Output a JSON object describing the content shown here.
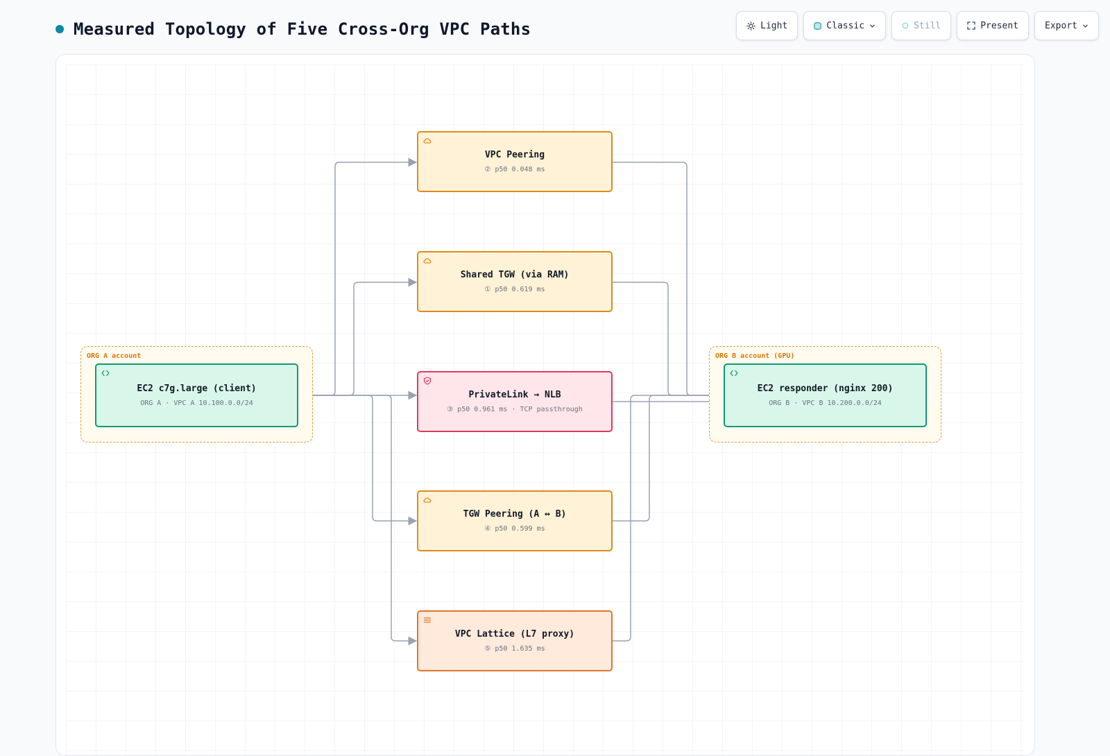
{
  "header": {
    "title": "Measured Topology of Five Cross-Org VPC Paths",
    "accent_color": "#0e87a8"
  },
  "toolbar": {
    "light": {
      "label": "Light",
      "icon": "sun-icon"
    },
    "classic": {
      "label": "Classic",
      "icon": "palette-swatch-icon"
    },
    "still": {
      "label": "Still",
      "icon": "circle-icon"
    },
    "present": {
      "label": "Present",
      "icon": "fullscreen-icon"
    },
    "export": {
      "label": "Export",
      "icon": "chevron-down-icon"
    }
  },
  "groups": {
    "org_a": {
      "label": "ORG A account"
    },
    "org_b": {
      "label": "ORG B account (GPU)"
    }
  },
  "nodes": {
    "client": {
      "title": "EC2 c7g.large (client)",
      "subtitle": "ORG A · VPC A 10.100.0.0/24",
      "icon": "code-icon"
    },
    "responder": {
      "title": "EC2 responder (nginx 200)",
      "subtitle": "ORG B · VPC B 10.200.0.0/24",
      "icon": "code-icon"
    },
    "vpc_peering": {
      "title": "VPC Peering",
      "subtitle": "② p50 0.048 ms",
      "icon": "cloud-icon"
    },
    "shared_tgw": {
      "title": "Shared TGW (via RAM)",
      "subtitle": "① p50 0.619 ms",
      "icon": "cloud-icon"
    },
    "privatelink": {
      "title": "PrivateLink → NLB",
      "subtitle": "③ p50 0.961 ms · TCP passthrough",
      "icon": "shield-icon"
    },
    "tgw_peering": {
      "title": "TGW Peering (A ↔ B)",
      "subtitle": "④ p50 0.599 ms",
      "icon": "cloud-icon"
    },
    "lattice": {
      "title": "VPC Lattice (L7 proxy)",
      "subtitle": "⑤ p50 1.635 ms",
      "icon": "menu-lines-icon"
    }
  },
  "colors": {
    "ec2_border": "#0f9a73",
    "ec2_fill": "#d9f6ea",
    "cloud_border": "#dd8a1c",
    "cloud_fill": "#fff2d6",
    "privatelink_border": "#de3a5e",
    "privatelink_fill": "#ffe6ea",
    "lattice_border": "#e07528",
    "lattice_fill": "#ffeadb",
    "group_border": "#e59a3c",
    "edge": "#9aa3b0"
  }
}
